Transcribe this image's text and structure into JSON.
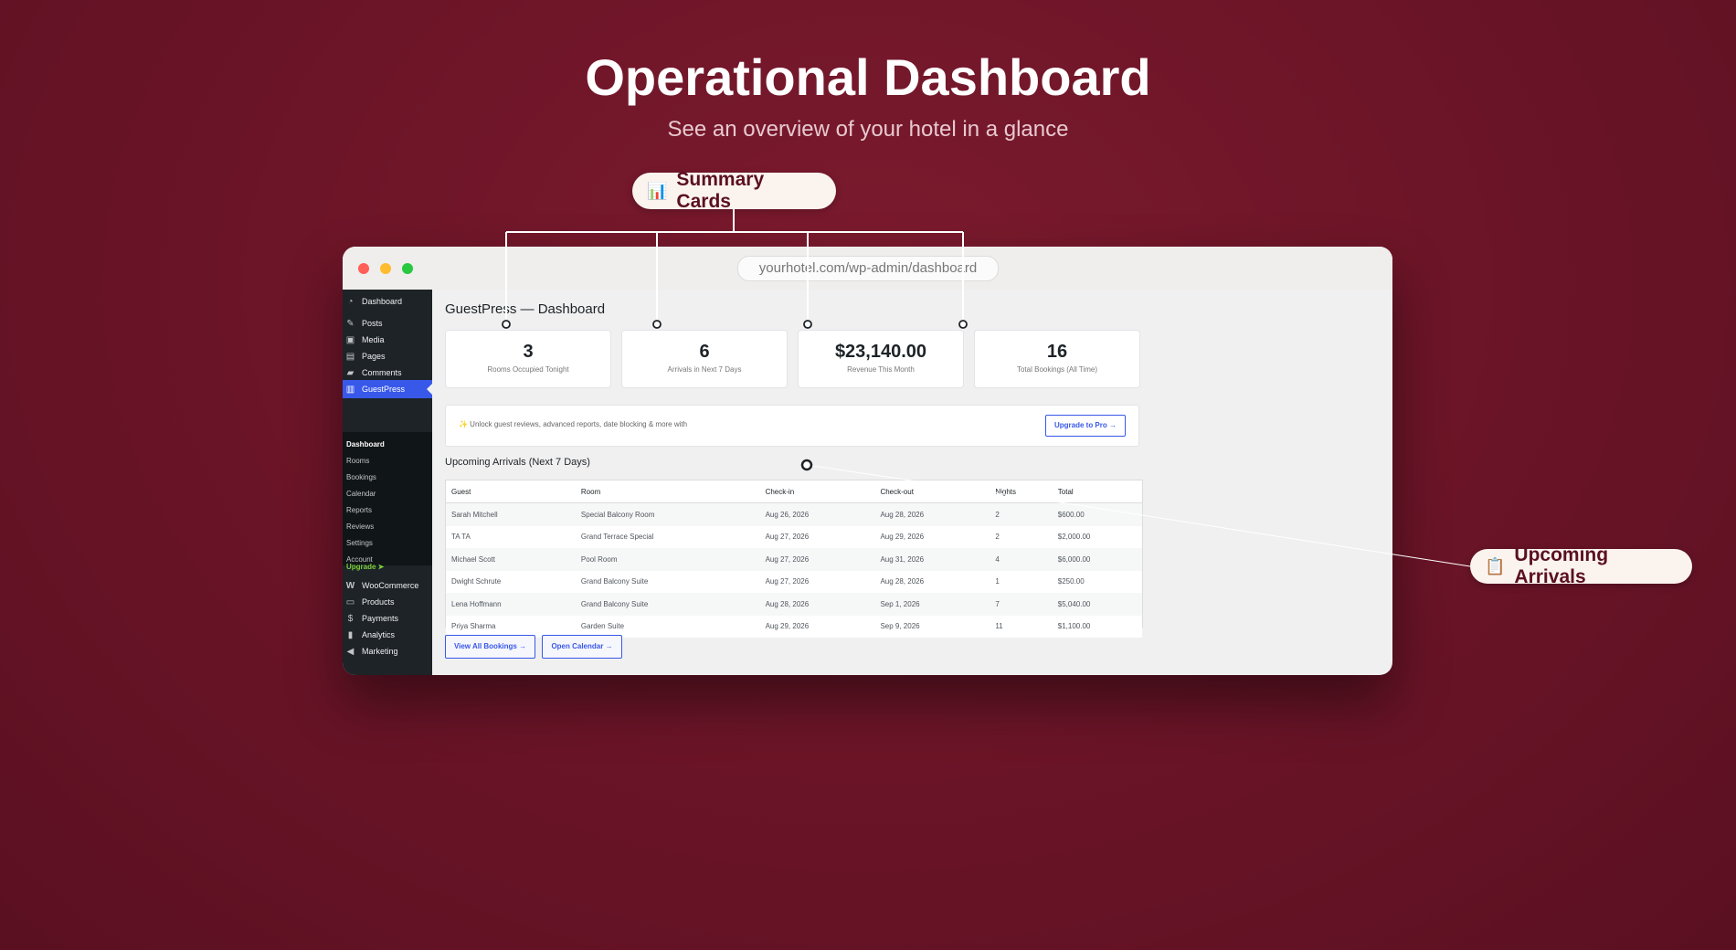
{
  "hero": {
    "title": "Operational Dashboard",
    "subtitle": "See an overview of your hotel in a glance"
  },
  "callouts": {
    "summary": {
      "icon": "📊",
      "label": "Summary Cards"
    },
    "arrivals": {
      "icon": "📋",
      "label": "Upcoming Arrivals"
    }
  },
  "browser": {
    "url": "yourhotel.com/wp-admin/dashboard"
  },
  "sidebar": {
    "items": [
      {
        "label": "Dashboard",
        "icon": "dashboard-icon"
      },
      {
        "label": "Posts",
        "icon": "pin-icon"
      },
      {
        "label": "Media",
        "icon": "media-icon"
      },
      {
        "label": "Pages",
        "icon": "pages-icon"
      },
      {
        "label": "Comments",
        "icon": "comments-icon"
      },
      {
        "label": "GuestPress",
        "icon": "building-icon"
      },
      {
        "label": "WooCommerce",
        "icon": "woocommerce-icon"
      },
      {
        "label": "Products",
        "icon": "products-icon"
      },
      {
        "label": "Payments",
        "icon": "payments-icon"
      },
      {
        "label": "Analytics",
        "icon": "analytics-icon"
      },
      {
        "label": "Marketing",
        "icon": "megaphone-icon"
      }
    ],
    "submenu": [
      "Dashboard",
      "Rooms",
      "Bookings",
      "Calendar",
      "Reports",
      "Reviews",
      "Settings",
      "Account",
      "Upgrade ➤"
    ]
  },
  "main": {
    "page_title": "GuestPress — Dashboard",
    "cards": [
      {
        "value": "3",
        "label": "Rooms Occupied Tonight"
      },
      {
        "value": "6",
        "label": "Arrivals in Next 7 Days"
      },
      {
        "value": "$23,140.00",
        "label": "Revenue This Month"
      },
      {
        "value": "16",
        "label": "Total Bookings (All Time)"
      }
    ],
    "promo": {
      "text": "✨ Unlock guest reviews, advanced reports, date blocking & more with",
      "button": "Upgrade to Pro →"
    },
    "arrivals": {
      "title": "Upcoming Arrivals (Next 7 Days)",
      "columns": [
        "Guest",
        "Room",
        "Check-in",
        "Check-out",
        "Nights",
        "Total"
      ],
      "rows": [
        [
          "Sarah Mitchell",
          "Special Balcony Room",
          "Aug 26, 2026",
          "Aug 28, 2026",
          "2",
          "$600.00"
        ],
        [
          "TA TA",
          "Grand Terrace Special",
          "Aug 27, 2026",
          "Aug 29, 2026",
          "2",
          "$2,000.00"
        ],
        [
          "Michael Scott",
          "Pool Room",
          "Aug 27, 2026",
          "Aug 31, 2026",
          "4",
          "$6,000.00"
        ],
        [
          "Dwight Schrute",
          "Grand Balcony Suite",
          "Aug 27, 2026",
          "Aug 28, 2026",
          "1",
          "$250.00"
        ],
        [
          "Lena Hoffmann",
          "Grand Balcony Suite",
          "Aug 28, 2026",
          "Sep 1, 2026",
          "7",
          "$5,040.00"
        ],
        [
          "Priya Sharma",
          "Garden Suite",
          "Aug 29, 2026",
          "Sep 9, 2026",
          "11",
          "$1,100.00"
        ]
      ]
    },
    "buttons": {
      "view_all": "View All Bookings →",
      "open_calendar": "Open Calendar →"
    }
  },
  "colors": {
    "background": "#6a1427",
    "accent": "#3858e9",
    "upgrade": "#7ad03a",
    "sidebar": "#1d2327"
  }
}
